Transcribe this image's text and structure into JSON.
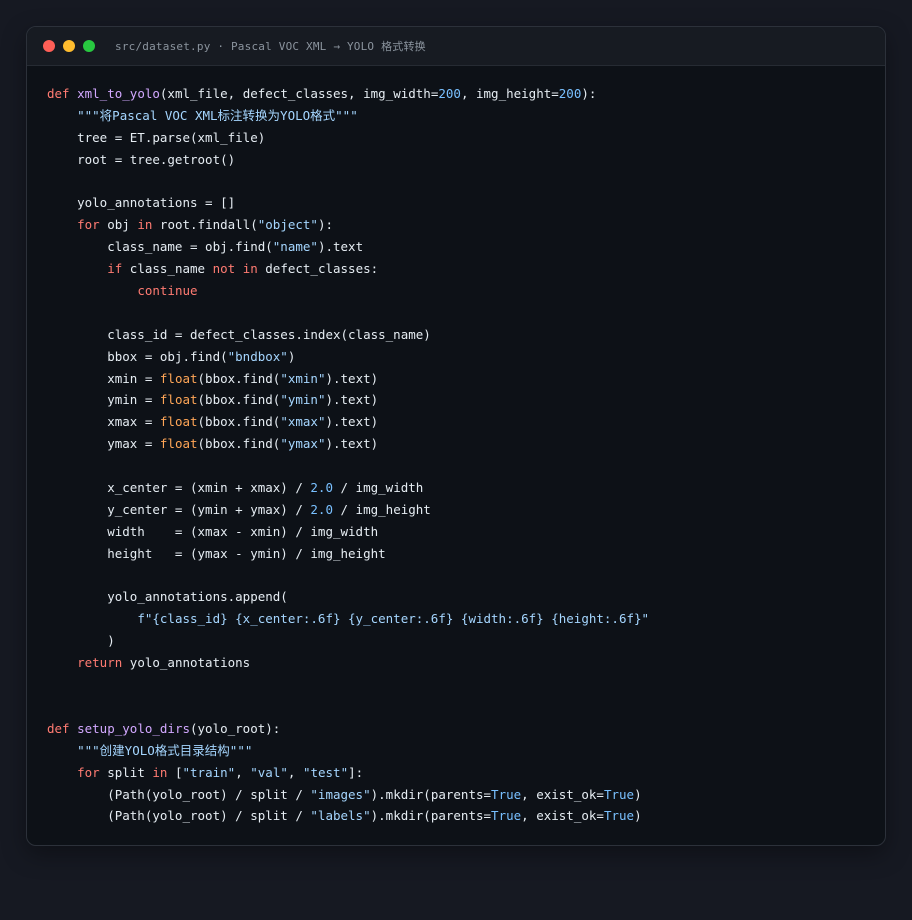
{
  "window": {
    "title": "src/dataset.py · Pascal VOC XML → YOLO 格式转换",
    "buttons": {
      "close": "#ff5f57",
      "minimize": "#febc2e",
      "maximize": "#28c840"
    }
  },
  "colors": {
    "keyword": "#ff7b72",
    "function": "#d2a8ff",
    "string": "#a5d6ff",
    "number": "#79c0ff",
    "builtin": "#ffa657",
    "text": "#e6edf3"
  },
  "code_lines": [
    [
      [
        "kw",
        "def "
      ],
      [
        "fn",
        "xml_to_yolo"
      ],
      [
        "tx",
        "(xml_file, defect_classes, img_width="
      ],
      [
        "num",
        "200"
      ],
      [
        "tx",
        ", img_height="
      ],
      [
        "num",
        "200"
      ],
      [
        "tx",
        "):"
      ]
    ],
    [
      [
        "tx",
        "    "
      ],
      [
        "str",
        "\"\"\"将Pascal VOC XML标注转换为YOLO格式\"\"\""
      ]
    ],
    [
      [
        "tx",
        "    tree = ET.parse(xml_file)"
      ]
    ],
    [
      [
        "tx",
        "    root = tree.getroot()"
      ]
    ],
    [],
    [
      [
        "tx",
        "    yolo_annotations = []"
      ]
    ],
    [
      [
        "tx",
        "    "
      ],
      [
        "kw",
        "for"
      ],
      [
        "tx",
        " obj "
      ],
      [
        "kw",
        "in"
      ],
      [
        "tx",
        " root.findall("
      ],
      [
        "str",
        "\"object\""
      ],
      [
        "tx",
        "):"
      ]
    ],
    [
      [
        "tx",
        "        class_name = obj.find("
      ],
      [
        "str",
        "\"name\""
      ],
      [
        "tx",
        ").text"
      ]
    ],
    [
      [
        "tx",
        "        "
      ],
      [
        "kw",
        "if"
      ],
      [
        "tx",
        " class_name "
      ],
      [
        "kw",
        "not in"
      ],
      [
        "tx",
        " defect_classes:"
      ]
    ],
    [
      [
        "tx",
        "            "
      ],
      [
        "kw",
        "continue"
      ]
    ],
    [],
    [
      [
        "tx",
        "        class_id = defect_classes.index(class_name)"
      ]
    ],
    [
      [
        "tx",
        "        bbox = obj.find("
      ],
      [
        "str",
        "\"bndbox\""
      ],
      [
        "tx",
        ")"
      ]
    ],
    [
      [
        "tx",
        "        xmin = "
      ],
      [
        "bi",
        "float"
      ],
      [
        "tx",
        "(bbox.find("
      ],
      [
        "str",
        "\"xmin\""
      ],
      [
        "tx",
        ").text)"
      ]
    ],
    [
      [
        "tx",
        "        ymin = "
      ],
      [
        "bi",
        "float"
      ],
      [
        "tx",
        "(bbox.find("
      ],
      [
        "str",
        "\"ymin\""
      ],
      [
        "tx",
        ").text)"
      ]
    ],
    [
      [
        "tx",
        "        xmax = "
      ],
      [
        "bi",
        "float"
      ],
      [
        "tx",
        "(bbox.find("
      ],
      [
        "str",
        "\"xmax\""
      ],
      [
        "tx",
        ").text)"
      ]
    ],
    [
      [
        "tx",
        "        ymax = "
      ],
      [
        "bi",
        "float"
      ],
      [
        "tx",
        "(bbox.find("
      ],
      [
        "str",
        "\"ymax\""
      ],
      [
        "tx",
        ").text)"
      ]
    ],
    [],
    [
      [
        "tx",
        "        x_center = (xmin + xmax) / "
      ],
      [
        "num",
        "2.0"
      ],
      [
        "tx",
        " / img_width"
      ]
    ],
    [
      [
        "tx",
        "        y_center = (ymin + ymax) / "
      ],
      [
        "num",
        "2.0"
      ],
      [
        "tx",
        " / img_height"
      ]
    ],
    [
      [
        "tx",
        "        width    = (xmax - xmin) / img_width"
      ]
    ],
    [
      [
        "tx",
        "        height   = (ymax - ymin) / img_height"
      ]
    ],
    [],
    [
      [
        "tx",
        "        yolo_annotations.append("
      ]
    ],
    [
      [
        "tx",
        "            "
      ],
      [
        "str",
        "f\"{class_id} {x_center:.6f} {y_center:.6f} {width:.6f} {height:.6f}\""
      ]
    ],
    [
      [
        "tx",
        "        )"
      ]
    ],
    [
      [
        "tx",
        "    "
      ],
      [
        "kw",
        "return"
      ],
      [
        "tx",
        " yolo_annotations"
      ]
    ],
    [],
    [],
    [
      [
        "kw",
        "def "
      ],
      [
        "fn",
        "setup_yolo_dirs"
      ],
      [
        "tx",
        "(yolo_root):"
      ]
    ],
    [
      [
        "tx",
        "    "
      ],
      [
        "str",
        "\"\"\"创建YOLO格式目录结构\"\"\""
      ]
    ],
    [
      [
        "tx",
        "    "
      ],
      [
        "kw",
        "for"
      ],
      [
        "tx",
        " split "
      ],
      [
        "kw",
        "in"
      ],
      [
        "tx",
        " ["
      ],
      [
        "str",
        "\"train\""
      ],
      [
        "tx",
        ", "
      ],
      [
        "str",
        "\"val\""
      ],
      [
        "tx",
        ", "
      ],
      [
        "str",
        "\"test\""
      ],
      [
        "tx",
        "]:"
      ]
    ],
    [
      [
        "tx",
        "        (Path(yolo_root) / split / "
      ],
      [
        "str",
        "\"images\""
      ],
      [
        "tx",
        ").mkdir(parents="
      ],
      [
        "num",
        "True"
      ],
      [
        "tx",
        ", exist_ok="
      ],
      [
        "num",
        "True"
      ],
      [
        "tx",
        ")"
      ]
    ],
    [
      [
        "tx",
        "        (Path(yolo_root) / split / "
      ],
      [
        "str",
        "\"labels\""
      ],
      [
        "tx",
        ").mkdir(parents="
      ],
      [
        "num",
        "True"
      ],
      [
        "tx",
        ", exist_ok="
      ],
      [
        "num",
        "True"
      ],
      [
        "tx",
        ")"
      ]
    ]
  ]
}
